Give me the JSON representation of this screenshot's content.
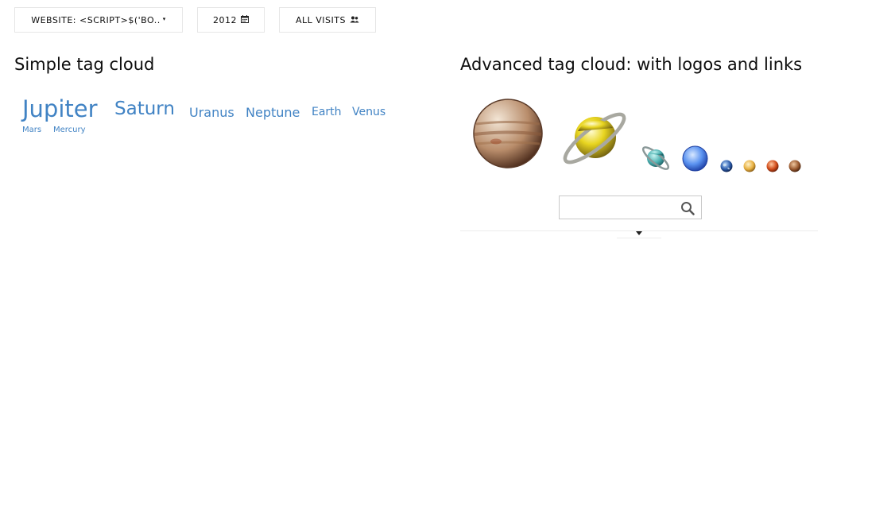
{
  "selectors": {
    "website": {
      "label": "WEBSITE: <SCRIPT>$('BO..",
      "caret": "▾"
    },
    "period": {
      "label": "2012"
    },
    "segment": {
      "label": "ALL VISITS"
    }
  },
  "simple_cloud": {
    "title": "Simple tag cloud",
    "tags": [
      "Jupiter",
      "Saturn",
      "Uranus",
      "Neptune",
      "Earth",
      "Venus",
      "Mars",
      "Mercury"
    ]
  },
  "advanced_cloud": {
    "title": "Advanced tag cloud: with logos and links",
    "planets": [
      "jupiter",
      "saturn",
      "uranus",
      "neptune",
      "earth",
      "venus",
      "mars",
      "mercury"
    ],
    "search": {
      "value": "",
      "placeholder": ""
    }
  },
  "colors": {
    "link": "#4183c4",
    "text": "#0d0d0d",
    "border": "#e6e6e6"
  },
  "icons": {
    "period": "calendar-icon",
    "segment": "users-icon",
    "search": "search-icon",
    "expand": "caret-down-icon"
  }
}
